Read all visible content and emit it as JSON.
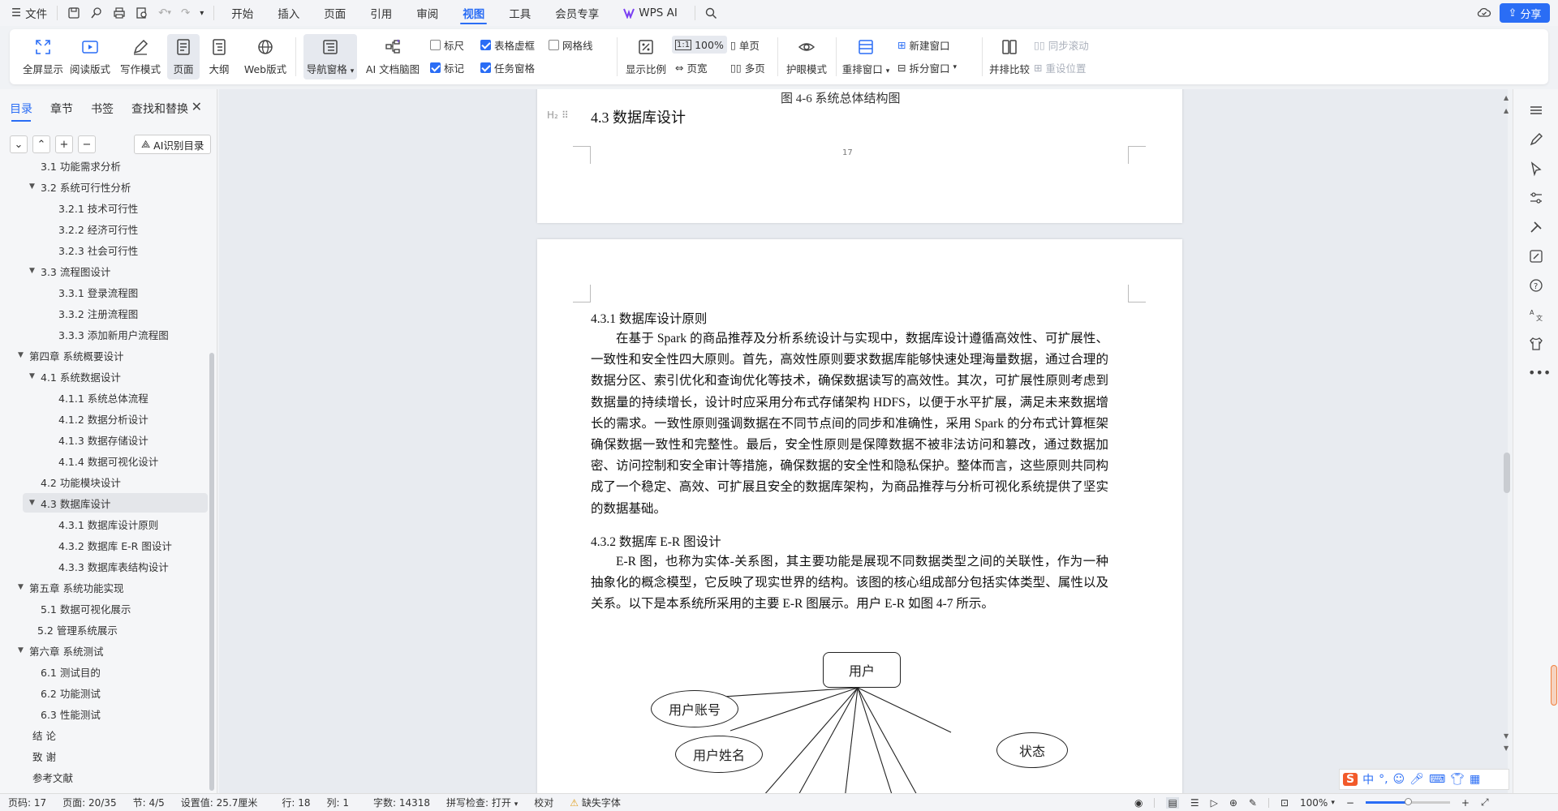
{
  "menubar": {
    "file": "文件",
    "tabs": [
      "开始",
      "插入",
      "页面",
      "引用",
      "审阅",
      "视图",
      "工具",
      "会员专享",
      "WPS AI"
    ],
    "active_tab": "视图",
    "share": "分享"
  },
  "ribbon": {
    "fullscreen": "全屏显示",
    "read_mode": "阅读版式",
    "write_mode": "写作模式",
    "page": "页面",
    "outline": "大纲",
    "web": "Web版式",
    "nav_pane": "导航窗格",
    "ai_mindmap": "AI 文档脑图",
    "ruler": "标尺",
    "table_gridlines": "表格虚框",
    "gridlines": "网格线",
    "marks": "标记",
    "task_pane": "任务窗格",
    "zoom_ratio": "显示比例",
    "zoom_100": "100%",
    "page_width": "页宽",
    "single_page": "单页",
    "multi_page": "多页",
    "eye_protect": "护眼模式",
    "rearrange": "重排窗口",
    "new_window": "新建窗口",
    "split_window": "拆分窗口",
    "side_by_side": "并排比较",
    "sync_scroll": "同步滚动",
    "reset_position": "重设位置",
    "checkbox_state": {
      "ruler": false,
      "table_gridlines": true,
      "gridlines": false,
      "marks": true,
      "task_pane": true
    }
  },
  "sidebar": {
    "tabs": [
      "目录",
      "章节",
      "书签",
      "查找和替换"
    ],
    "active_tab": "目录",
    "ai_toc": "AI识别目录",
    "items": [
      {
        "text": "3.1 功能需求分析",
        "level": 2,
        "arrow": false
      },
      {
        "text": "3.2 系统可行性分析",
        "level": 2,
        "arrow": true
      },
      {
        "text": "3.2.1 技术可行性",
        "level": 3,
        "arrow": false
      },
      {
        "text": "3.2.2  经济可行性",
        "level": 3,
        "arrow": false
      },
      {
        "text": "3.2.3  社会可行性",
        "level": 3,
        "arrow": false
      },
      {
        "text": "3.3 流程图设计",
        "level": 2,
        "arrow": true
      },
      {
        "text": "3.3.1  登录流程图",
        "level": 3,
        "arrow": false
      },
      {
        "text": "3.3.2  注册流程图",
        "level": 3,
        "arrow": false
      },
      {
        "text": "3.3.3  添加新用户流程图",
        "level": 3,
        "arrow": false
      },
      {
        "text": "第四章  系统概要设计",
        "level": 1,
        "arrow": true
      },
      {
        "text": "4.1 系统数据设计",
        "level": 2,
        "arrow": true
      },
      {
        "text": "4.1.1     系统总体流程",
        "level": 3,
        "arrow": false
      },
      {
        "text": "4.1.2     数据分析设计",
        "level": 3,
        "arrow": false
      },
      {
        "text": "4.1.3     数据存储设计",
        "level": 3,
        "arrow": false
      },
      {
        "text": "4.1.4     数据可视化设计",
        "level": 3,
        "arrow": false
      },
      {
        "text": "4.2 功能模块设计",
        "level": 2,
        "arrow": false
      },
      {
        "text": "4.3  数据库设计",
        "level": 2,
        "arrow": true,
        "highlight": true
      },
      {
        "text": "4.3.1 数据库设计原则",
        "level": 3,
        "arrow": false
      },
      {
        "text": "4.3.2 数据库 E-R 图设计",
        "level": 3,
        "arrow": false
      },
      {
        "text": "4.3.3 数据库表结构设计",
        "level": 3,
        "arrow": false
      },
      {
        "text": "第五章  系统功能实现",
        "level": 1,
        "arrow": true
      },
      {
        "text": "5.1  数据可视化展示",
        "level": 2,
        "arrow": false
      },
      {
        "text": "5.2  管理系统展示",
        "level": 2,
        "arrow": false,
        "indent_alt": true
      },
      {
        "text": "第六章  系统测试",
        "level": 1,
        "arrow": true
      },
      {
        "text": "6.1  测试目的",
        "level": 2,
        "arrow": false
      },
      {
        "text": "6.2  功能测试",
        "level": 2,
        "arrow": false
      },
      {
        "text": "6.3 性能测试",
        "level": 2,
        "arrow": false
      },
      {
        "text": "结      论",
        "level": 1,
        "arrow": false
      },
      {
        "text": "致    谢",
        "level": 1,
        "arrow": false
      },
      {
        "text": "参考文献",
        "level": 1,
        "arrow": false
      }
    ]
  },
  "document": {
    "page1": {
      "fig_caption": "图 4-6  系统总体结构图",
      "heading_mark": "H₂",
      "heading": "4.3  数据库设计",
      "page_number": "17"
    },
    "page2": {
      "sub1": "4.3.1 数据库设计原则",
      "para1": "在基于 Spark 的商品推荐及分析系统设计与实现中，数据库设计遵循高效性、可扩展性、一致性和安全性四大原则。首先，高效性原则要求数据库能够快速处理海量数据，通过合理的数据分区、索引优化和查询优化等技术，确保数据读写的高效性。其次，可扩展性原则考虑到数据量的持续增长，设计时应采用分布式存储架构 HDFS，以便于水平扩展，满足未来数据增长的需求。一致性原则强调数据在不同节点间的同步和准确性，采用 Spark 的分布式计算框架确保数据一致性和完整性。最后，安全性原则是保障数据不被非法访问和篡改，通过数据加密、访问控制和安全审计等措施，确保数据的安全性和隐私保护。整体而言，这些原则共同构成了一个稳定、高效、可扩展且安全的数据库架构，为商品推荐与分析可视化系统提供了坚实的数据基础。",
      "sub2": "4.3.2 数据库 E-R 图设计",
      "para2": "E-R 图，也称为实体-关系图，其主要功能是展现不同数据类型之间的关联性，作为一种抽象化的概念模型，它反映了现实世界的结构。该图的核心组成部分包括实体类型、属性以及关系。以下是本系统所采用的主要 E-R 图展示。用户 E-R 如图 4-7 所示。",
      "er": {
        "entity": "用户",
        "attributes": [
          "用户账号",
          "用户姓名",
          "状态"
        ]
      }
    }
  },
  "statusbar": {
    "page_no": "页码: 17",
    "pages": "页面: 20/35",
    "section": "节: 4/5",
    "setting": "设置值: 25.7厘米",
    "row": "行: 18",
    "col": "列: 1",
    "words": "字数: 14318",
    "spell": "拼写检查: 打开",
    "proof": "校对",
    "missing_font": "缺失字体",
    "zoom": "100%"
  },
  "ime": {
    "lang": "中"
  }
}
